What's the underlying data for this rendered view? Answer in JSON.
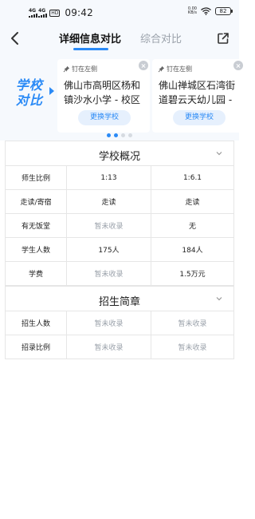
{
  "status_bar": {
    "signal1": "4G",
    "signal2": "4G",
    "hd": "HD",
    "time": "09:42",
    "speed_value": "0.00",
    "speed_unit": "KB/s",
    "battery": "82"
  },
  "header": {
    "tabs": [
      {
        "label": "详细信息对比",
        "active": true
      },
      {
        "label": "综合对比",
        "active": false
      }
    ]
  },
  "compare_logo": {
    "line1": "学校",
    "line2": "对比"
  },
  "schools": [
    {
      "pin_label": "钉在左侧",
      "name": "佛山市高明区杨和镇沙水小学 - 校区",
      "change_label": "更换学校"
    },
    {
      "pin_label": "钉在左侧",
      "name": "佛山禅城区石湾街道碧云天幼儿园 - 园区",
      "change_label": "更换学校"
    }
  ],
  "carousel": {
    "pages": 4,
    "active_index": 1
  },
  "sections": [
    {
      "title": "学校概况",
      "rows": [
        {
          "label": "师生比例",
          "values": [
            "1:13",
            "1:6.1"
          ]
        },
        {
          "label": "走读/寄宿",
          "values": [
            "走读",
            "走读"
          ]
        },
        {
          "label": "有无饭堂",
          "values": [
            "暂未收录",
            "无"
          ]
        },
        {
          "label": "学生人数",
          "values": [
            "175人",
            "184人"
          ]
        },
        {
          "label": "学费",
          "values": [
            "暂未收录",
            "1.5万元"
          ]
        }
      ]
    },
    {
      "title": "招生简章",
      "rows": [
        {
          "label": "招生人数",
          "values": [
            "暂未收录",
            "暂未收录"
          ]
        },
        {
          "label": "招录比例",
          "values": [
            "暂未收录",
            "暂未收录"
          ]
        }
      ]
    }
  ],
  "colors": {
    "accent": "#2a8af6",
    "muted_text": "#9aa1aa",
    "header_bg": "#f6f9fd"
  },
  "icons": {
    "back": "chevron-left-icon",
    "share": "share-external-icon",
    "pin": "pin-icon",
    "close": "close-icon",
    "collapse": "chevron-down-icon"
  }
}
